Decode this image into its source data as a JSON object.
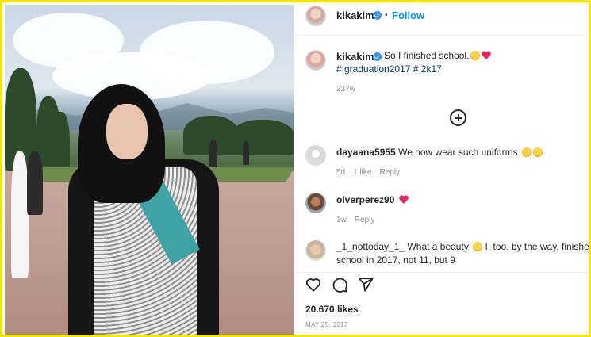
{
  "post": {
    "author": "kikakim",
    "follow_label": "Follow",
    "dot": "•",
    "caption": "So I finished school.",
    "hashtags": [
      "# graduation2017",
      "# 2k17"
    ],
    "caption_time": "237w",
    "likes": "20.670 likes",
    "date": "MAY 25, 2017"
  },
  "comments": [
    {
      "user": "dayaana5955",
      "text": "We now wear such uniforms",
      "time": "5d",
      "likes": "1 like",
      "reply": "Reply"
    },
    {
      "user": "olverperez90",
      "text": "",
      "time": "1w",
      "reply": "Reply"
    },
    {
      "user": "_1_nottoday_1_",
      "text_line1": "What a beauty",
      "text_line1b": "I, too, by the way, finished",
      "text_line2": "school in 2017, not 11, but 9"
    }
  ],
  "icons": [
    "heart-icon",
    "comment-icon",
    "share-icon",
    "add-comment-icon",
    "verified-icon"
  ],
  "colors": {
    "accent": "#0095f6",
    "frame": "#f2e500",
    "hashtag": "#00376b",
    "muted": "#8e8e8e"
  }
}
